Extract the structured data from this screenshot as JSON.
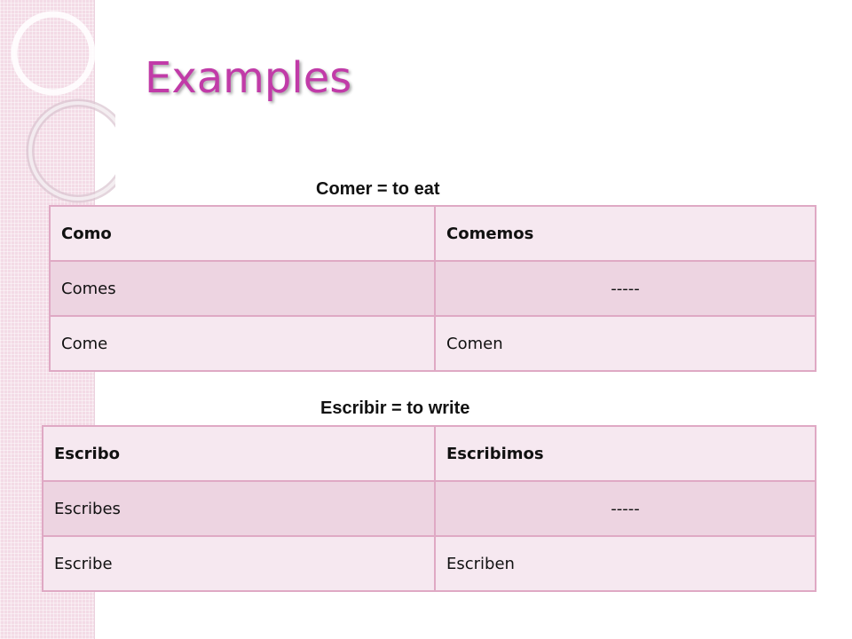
{
  "slide": {
    "title": "Examples"
  },
  "tables": [
    {
      "caption": "Comer = to eat",
      "rows": [
        [
          "Como",
          "Comemos"
        ],
        [
          "Comes",
          "-----"
        ],
        [
          "Come",
          "Comen"
        ]
      ]
    },
    {
      "caption": "Escribir = to write",
      "rows": [
        [
          "Escribo",
          "Escribimos"
        ],
        [
          "Escribes",
          "-----"
        ],
        [
          "Escribe",
          "Escriben"
        ]
      ]
    }
  ],
  "colors": {
    "title": "#c13ba8",
    "row_light": "#f6e8f0",
    "row_dark": "#edd4e1",
    "border": "#dfa9c4",
    "strip": "#f3dbe6"
  }
}
